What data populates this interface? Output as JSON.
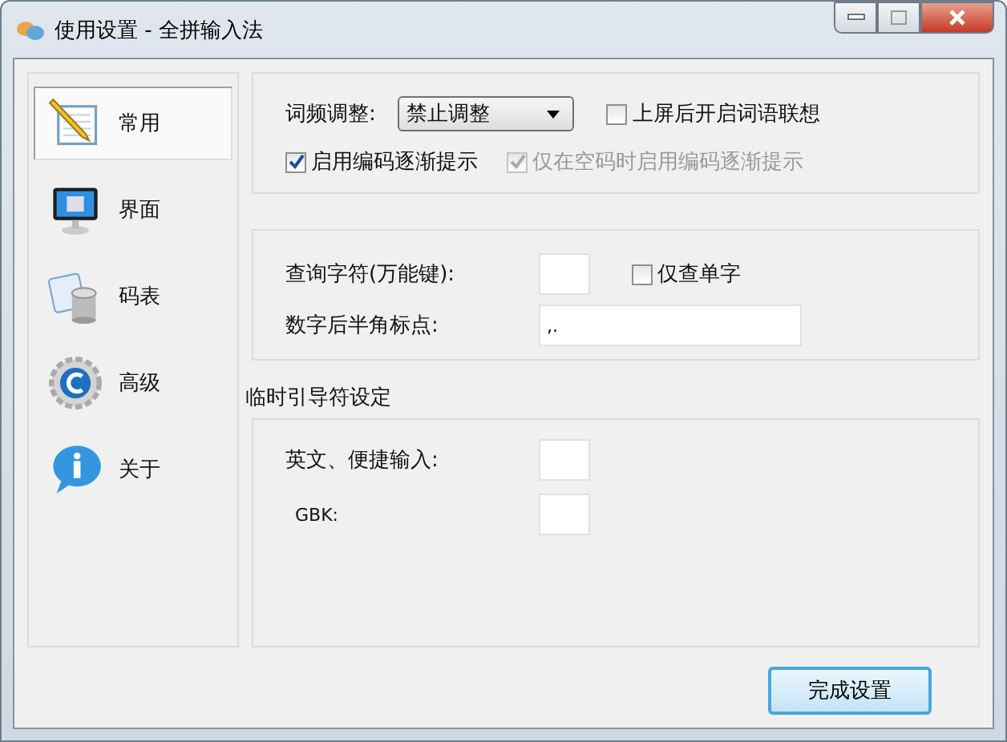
{
  "window": {
    "title": "使用设置 - 全拼输入法"
  },
  "sidebar": {
    "items": [
      {
        "label": "常用",
        "selected": true
      },
      {
        "label": "界面",
        "selected": false
      },
      {
        "label": "码表",
        "selected": false
      },
      {
        "label": "高级",
        "selected": false
      },
      {
        "label": "关于",
        "selected": false
      }
    ]
  },
  "general": {
    "freq_label": "词频调整:",
    "freq_value": "禁止调整",
    "checkboxes": [
      {
        "label": "上屏后开启词语联想",
        "checked": false,
        "disabled": false
      },
      {
        "label": "启用编码逐渐提示",
        "checked": true,
        "disabled": false
      },
      {
        "label": "仅在空码时启用编码逐渐提示",
        "checked": true,
        "disabled": true
      }
    ]
  },
  "query": {
    "wildcard_label": "查询字符(万能键):",
    "single_char": {
      "label": "仅查单字",
      "checked": false,
      "disabled": false
    },
    "punct_label": "数字后半角标点:",
    "punct_value": ",."
  },
  "guide": {
    "title": "临时引导符设定",
    "rows": [
      {
        "label": "英文、便捷输入:"
      },
      {
        "label": "GBK:"
      }
    ]
  },
  "buttons": [
    "完成设置"
  ]
}
